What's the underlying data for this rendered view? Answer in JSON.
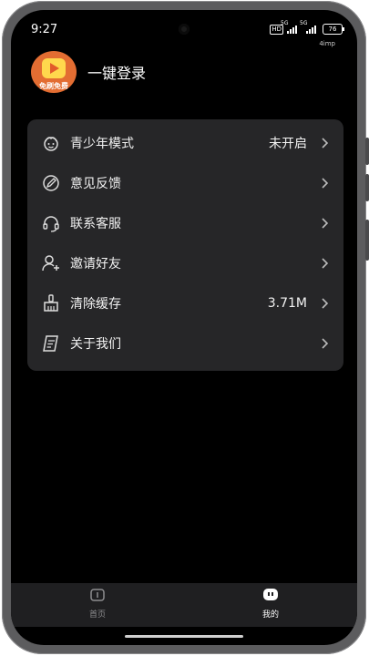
{
  "status_bar": {
    "time": "9:27",
    "hd_badge": "HD",
    "signal_1_label": "5G",
    "signal_2_label": "5G",
    "battery": "76",
    "net_speed": "4imp"
  },
  "login": {
    "avatar_text": "免刷免费",
    "label": "一键登录"
  },
  "menu": {
    "items": [
      {
        "label": "青少年模式",
        "value": "未开启",
        "icon": "child-face-icon"
      },
      {
        "label": "意见反馈",
        "value": "",
        "icon": "pencil-feedback-icon"
      },
      {
        "label": "联系客服",
        "value": "",
        "icon": "headset-icon"
      },
      {
        "label": "邀请好友",
        "value": "",
        "icon": "add-user-icon"
      },
      {
        "label": "清除缓存",
        "value": "3.71M",
        "icon": "broom-icon"
      },
      {
        "label": "关于我们",
        "value": "",
        "icon": "document-icon"
      }
    ]
  },
  "tabs": [
    {
      "label": "首页",
      "icon": "home-icon",
      "active": false
    },
    {
      "label": "我的",
      "icon": "profile-chat-icon",
      "active": true
    }
  ],
  "colors": {
    "background": "#000000",
    "card": "#262628",
    "tab_bar": "#1f1f21",
    "tab_inactive": "#8e8e90",
    "tab_active": "#ffffff"
  }
}
